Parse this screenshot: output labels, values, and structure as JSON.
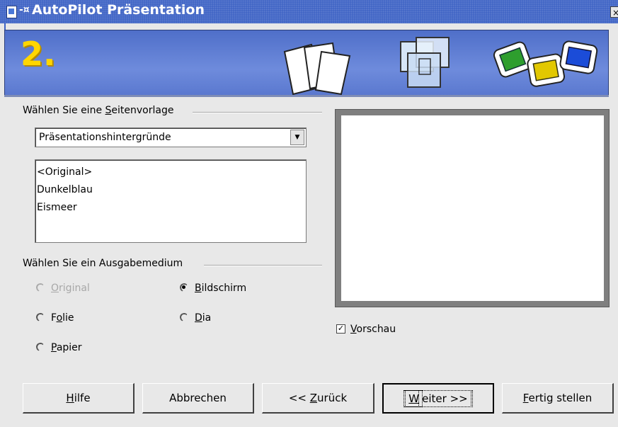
{
  "window": {
    "title": "AutoPilot Präsentation",
    "sys_glyph": "-¤",
    "close_glyph": "×"
  },
  "banner": {
    "step_number": "2."
  },
  "template_group": {
    "title_pre": "Wählen Sie eine ",
    "title_accel": "S",
    "title_post": "eitenvorlage",
    "dropdown_value": "Präsentationshintergründe",
    "dropdown_arrow": "▼",
    "list_items": [
      "<Original>",
      "Dunkelblau",
      "Eismeer"
    ]
  },
  "medium_group": {
    "title": "Wählen Sie ein Ausgabemedium",
    "options": [
      {
        "accel": "O",
        "rest": "riginal",
        "checked": false,
        "disabled": true
      },
      {
        "accel": "B",
        "rest": "ildschirm",
        "checked": true,
        "disabled": false
      },
      {
        "pre": "F",
        "accel": "o",
        "rest": "lie",
        "checked": false,
        "disabled": false
      },
      {
        "accel": "D",
        "rest": "ia",
        "checked": false,
        "disabled": false
      },
      {
        "accel": "P",
        "rest": "apier",
        "checked": false,
        "disabled": false
      }
    ]
  },
  "preview": {
    "checkbox_accel": "V",
    "checkbox_rest": "orschau",
    "checkbox_mark": "✓",
    "checked": true
  },
  "buttons": {
    "help": {
      "accel": "H",
      "rest": "ilfe"
    },
    "cancel": {
      "label": "Abbrechen"
    },
    "back": {
      "pre": "<< ",
      "accel": "Z",
      "rest": "urück"
    },
    "next": {
      "accel": "W",
      "rest": "eiter >>"
    },
    "finish": {
      "accel": "F",
      "rest": "ertig stellen"
    }
  },
  "colors": {
    "titlebar": "#3d62c4",
    "banner": "#6e8bdc",
    "step_number": "#ffd600"
  }
}
